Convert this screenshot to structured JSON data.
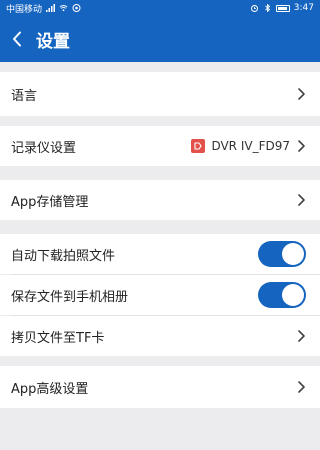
{
  "status_bar": {
    "carrier": "中国移动",
    "time": "3:47"
  },
  "header": {
    "title": "设置"
  },
  "settings": {
    "language": {
      "label": "语言"
    },
    "recorder": {
      "label": "记录仪设置",
      "device_name": "DVR IV_FD97"
    },
    "storage": {
      "label": "App存储管理"
    },
    "auto_download": {
      "label": "自动下载拍照文件",
      "enabled": true
    },
    "save_to_album": {
      "label": "保存文件到手机相册",
      "enabled": true
    },
    "copy_to_tf": {
      "label": "拷贝文件至TF卡"
    },
    "advanced": {
      "label": "App高级设置"
    }
  },
  "colors": {
    "accent": "#1565c0",
    "background": "#ececef",
    "device_badge": "#e4514a"
  }
}
